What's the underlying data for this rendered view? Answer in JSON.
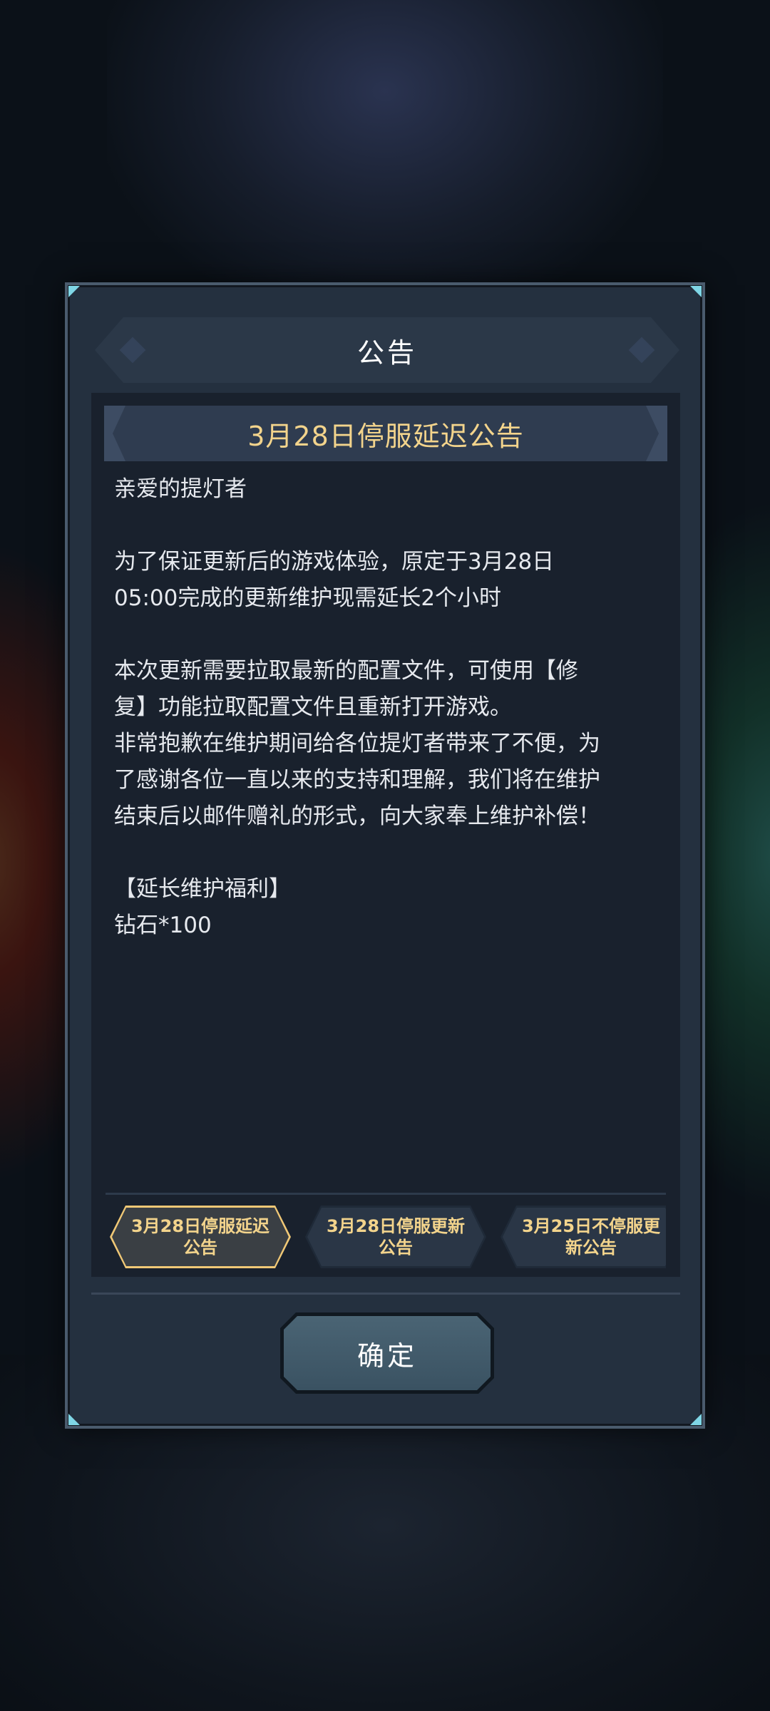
{
  "dialog": {
    "title": "公告",
    "subtitle": "3月28日停服延迟公告",
    "body": {
      "greeting": "亲爱的提灯者",
      "paragraph1": "为了保证更新后的游戏体验，原定于3月28日\n05:00完成的更新维护现需延长2个小时",
      "paragraph2": "本次更新需要拉取最新的配置文件，可使用【修\n复】功能拉取配置文件且重新打开游戏。\n非常抱歉在维护期间给各位提灯者带来了不便，为\n了感谢各位一直以来的支持和理解，我们将在维护\n结束后以邮件赠礼的形式，向大家奉上维护补偿！",
      "benefit_title": "【延长维护福利】",
      "benefit_item": "钻石*100"
    },
    "tabs": [
      {
        "label": "3月28日停服延迟\n公告",
        "active": true
      },
      {
        "label": "3月28日停服更新\n公告",
        "active": false
      },
      {
        "label": "3月25日不停服更\n新公告",
        "active": false
      }
    ],
    "confirm_label": "确定"
  },
  "colors": {
    "accent_gold": "#f3d48c",
    "panel_bg": "#19212d",
    "frame_bg": "#24303f",
    "button": "#4a6474"
  }
}
